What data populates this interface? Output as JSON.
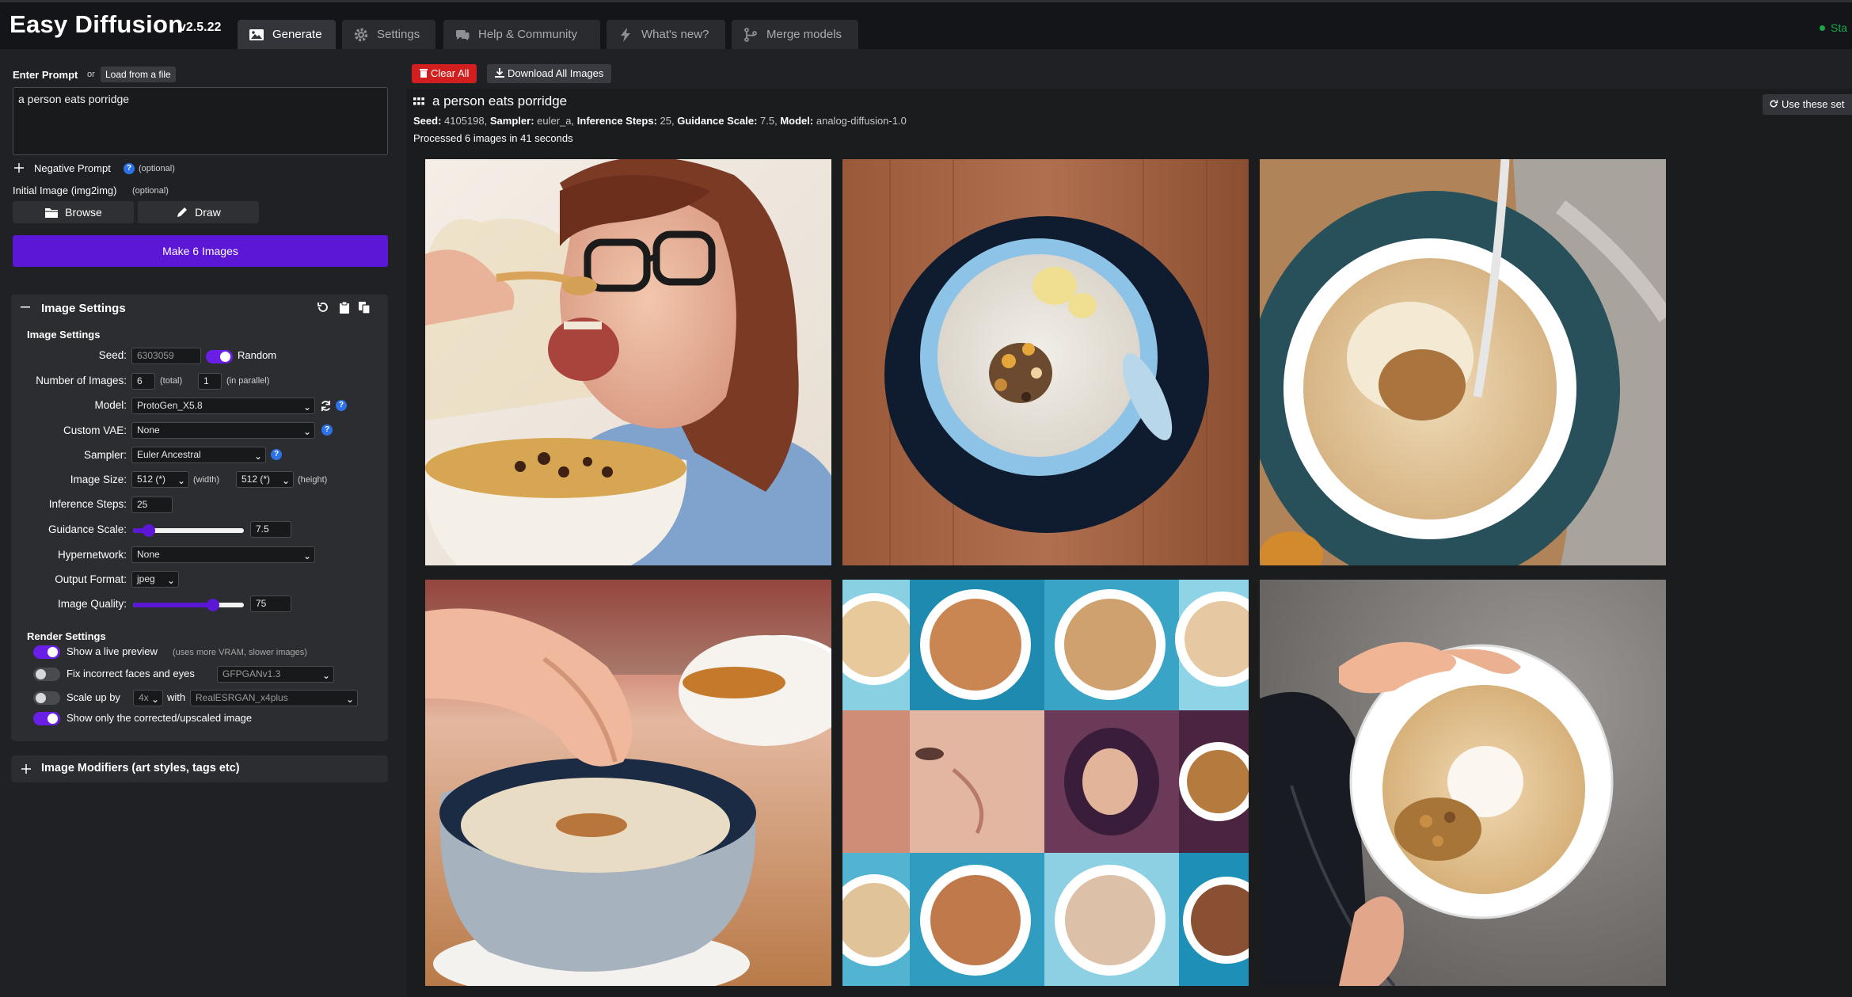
{
  "app": {
    "title": "Easy Diffusion",
    "version": "v2.5.22",
    "status": "Sta"
  },
  "tabs": [
    {
      "label": "Generate",
      "icon": "image-icon",
      "active": true
    },
    {
      "label": "Settings",
      "icon": "gear-icon",
      "active": false
    },
    {
      "label": "Help & Community",
      "icon": "chat-icon",
      "active": false
    },
    {
      "label": "What's new?",
      "icon": "bolt-icon",
      "active": false
    },
    {
      "label": "Merge models",
      "icon": "branch-icon",
      "active": false
    }
  ],
  "prompt": {
    "label": "Enter Prompt",
    "or_text": "or",
    "load_file_label": "Load from a file",
    "value": "a person eats porridge",
    "negative_label": "Negative Prompt",
    "optional": "(optional)",
    "initial_image_label": "Initial Image (img2img)",
    "browse_label": "Browse",
    "draw_label": "Draw",
    "make_button": "Make 6 Images"
  },
  "image_settings": {
    "panel_title": "Image Settings",
    "section_title": "Image Settings",
    "seed": {
      "label": "Seed:",
      "value": "6303059",
      "random_label": "Random",
      "random_on": true
    },
    "num_images": {
      "label": "Number of Images:",
      "total": "6",
      "total_hint": "(total)",
      "parallel": "1",
      "parallel_hint": "(in parallel)"
    },
    "model": {
      "label": "Model:",
      "value": "ProtoGen_X5.8"
    },
    "vae": {
      "label": "Custom VAE:",
      "value": "None"
    },
    "sampler": {
      "label": "Sampler:",
      "value": "Euler Ancestral"
    },
    "image_size": {
      "label": "Image Size:",
      "width": "512 (*)",
      "width_hint": "(width)",
      "height": "512 (*)",
      "height_hint": "(height)"
    },
    "steps": {
      "label": "Inference Steps:",
      "value": "25"
    },
    "guidance": {
      "label": "Guidance Scale:",
      "value": "7.5",
      "slider_fraction": 0.14
    },
    "hypernetwork": {
      "label": "Hypernetwork:",
      "value": "None"
    },
    "output_format": {
      "label": "Output Format:",
      "value": "jpeg"
    },
    "quality": {
      "label": "Image Quality:",
      "value": "75",
      "slider_fraction": 0.72
    }
  },
  "render_settings": {
    "title": "Render Settings",
    "live_preview": {
      "label": "Show a live preview",
      "hint": "(uses more VRAM, slower images)",
      "on": true
    },
    "fix_faces": {
      "label": "Fix incorrect faces and eyes",
      "model": "GFPGANv1.3",
      "on": false
    },
    "upscale": {
      "label": "Scale up by",
      "factor": "4x",
      "with_label": "with",
      "model": "RealESRGAN_x4plus",
      "on": false
    },
    "only_corrected": {
      "label": "Show only the corrected/upscaled image",
      "on": true
    }
  },
  "modifiers": {
    "title": "Image Modifiers (art styles, tags etc)"
  },
  "results": {
    "clear_all": "Clear All",
    "download_all": "Download All Images",
    "prompt_title": "a person eats porridge",
    "meta": {
      "seed_label": "Seed:",
      "seed": "4105198",
      "sampler_label": "Sampler:",
      "sampler": "euler_a",
      "steps_label": "Inference Steps:",
      "steps": "25",
      "guidance_label": "Guidance Scale:",
      "guidance": "7.5",
      "model_label": "Model:",
      "model": "analog-diffusion-1.0"
    },
    "processed": "Processed 6 images in 41 seconds",
    "use_settings": "Use these set",
    "images": [
      {
        "name": "woman eating porridge with glasses"
      },
      {
        "name": "porridge bowl on wooden table"
      },
      {
        "name": "porridge with spoon in teal bowl"
      },
      {
        "name": "hand reaching into porridge bowl"
      },
      {
        "name": "grid of bowls and faces"
      },
      {
        "name": "hand holding white porridge bowl"
      }
    ]
  },
  "colors": {
    "accent": "#5c16d6",
    "danger": "#d11f1f",
    "help": "#2d72e8",
    "status": "#18a84b"
  }
}
